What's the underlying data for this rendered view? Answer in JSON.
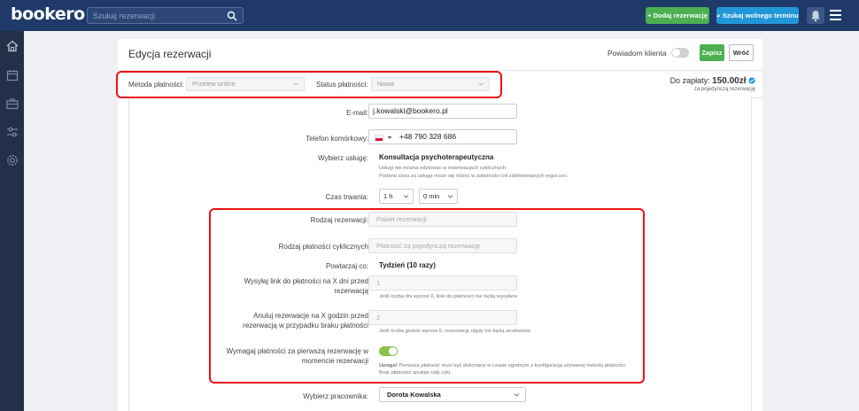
{
  "header": {
    "logo": "bookero",
    "search_placeholder": "Szukaj rezerwacji",
    "add_button": "+ Dodaj rezerwację",
    "find_button": "⌕ Szukaj wolnego terminu"
  },
  "sidebar": {
    "items": [
      {
        "icon": "home-icon"
      },
      {
        "icon": "calendar-icon"
      },
      {
        "icon": "briefcase-icon"
      },
      {
        "icon": "sliders-icon"
      },
      {
        "icon": "gear-icon"
      }
    ]
  },
  "page": {
    "title": "Edycja rezerwacji",
    "notify_label": "Powiadom klienta",
    "save_button": "Zapisz",
    "back_button": "Wróć"
  },
  "payment": {
    "method_label": "Metoda płatności:",
    "method_value": "Przelew online",
    "status_label": "Status płatności:",
    "status_value": "Nowa",
    "due_label": "Do zapłaty:",
    "due_amount": "150.00zł",
    "due_sub": "za pojedynczą rezerwację"
  },
  "form": {
    "email_label": "E-mail:",
    "email_value": "j.kowalski@bookero.pl",
    "phone_label": "Telefon komórkowy:",
    "phone_value": "+48 790 328 686",
    "service_label": "Wybierz usługę:",
    "service_value": "Konsultacja psychoterapeutyczna",
    "service_hint1": "Usługi nie można edytować w rezerwacjach cyklicznych",
    "service_hint2": "Podana cena za usługę może się różnić w zależności od zdefiniowanych reguł cen.",
    "duration_label": "Czas trwania:",
    "duration_hours": "1 h",
    "duration_minutes": "0 min",
    "reservation_type_label": "Rodzaj rezerwacji:",
    "reservation_type_value": "Pakiet rezerwacji",
    "cyclic_payment_label": "Rodzaj płatności cyklicznych",
    "cyclic_payment_value": "Płatność za pojedynczą rezerwację",
    "repeat_label": "Powtarzaj co:",
    "repeat_value": "Tydzień  (10 razy)",
    "send_link_label": "Wysyłaj link do płatności na X dni przed rezerwacją",
    "send_link_value": "1",
    "send_link_hint": "Jeśli liczba dni wynosi 0, linki do płatności nie będą wysyłane",
    "cancel_label": "Anuluj rezerwacje na X godzin przed rezerwacją w przypadku braku płatności",
    "cancel_value": "2",
    "cancel_hint": "Jeśli liczba godzin wynosi 0, rezerwację nigdy nie będą anulowane",
    "require_label": "Wymagaj płatności za pierwszą rezerwację w momencie rezerwacji",
    "require_note_bold": "Uwaga!",
    "require_note": " Pierwsza płatność musi być dokonana w czasie zgodnym z konfiguracją używanej metody płatności.",
    "require_note2": "Brak płatności anuluje cały cykl.",
    "employee_label": "Wybierz pracownika:",
    "employee_value": "Dorota Kowalska"
  }
}
